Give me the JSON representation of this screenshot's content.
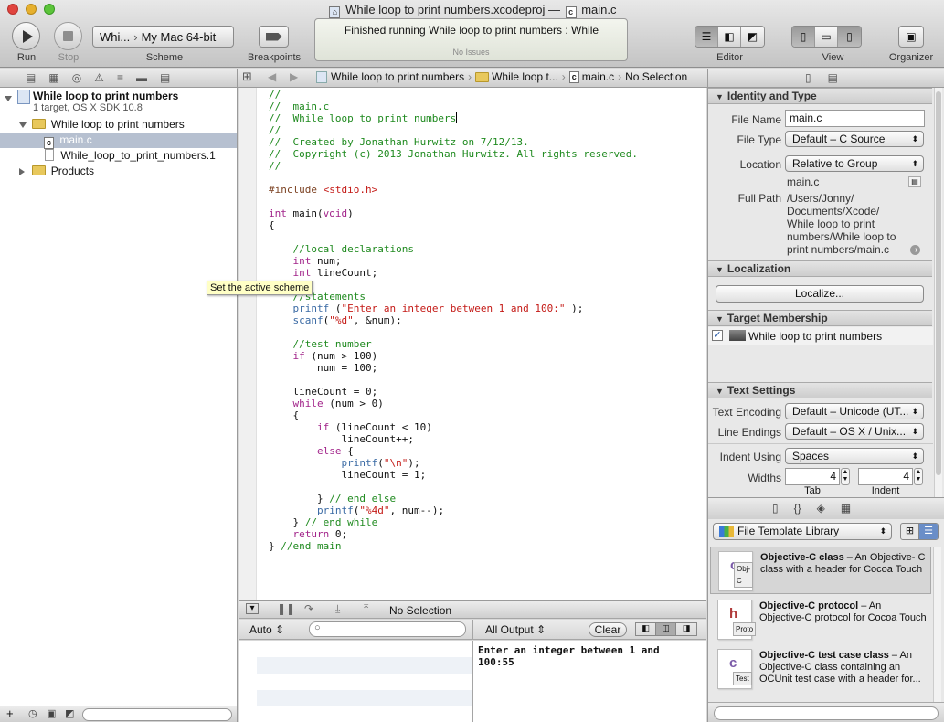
{
  "window": {
    "project_title": "While loop to print numbers.xcodeproj",
    "separator": "—",
    "file_title": "main.c",
    "file_badge": "c"
  },
  "toolbar": {
    "run_label": "Run",
    "stop_label": "Stop",
    "scheme_target": "Whi...",
    "scheme_destination": "My Mac 64-bit",
    "scheme_label": "Scheme",
    "breakpoints_label": "Breakpoints",
    "activity_status": "Finished running While loop to print numbers : While",
    "activity_issues": "No Issues",
    "editor_label": "Editor",
    "view_label": "View",
    "organizer_label": "Organizer"
  },
  "jumpbar": {
    "crumbs": [
      "While loop to print numbers",
      "While loop t...",
      "main.c",
      "No Selection"
    ]
  },
  "navigator": {
    "project": {
      "name": "While loop to print numbers",
      "subtitle": "1 target, OS X SDK 10.8"
    },
    "items": [
      {
        "label": "While loop to print numbers",
        "kind": "folder",
        "expanded": true
      },
      {
        "label": "main.c",
        "kind": "c-file",
        "selected": true
      },
      {
        "label": "While_loop_to_print_numbers.1",
        "kind": "file"
      },
      {
        "label": "Products",
        "kind": "folder",
        "expanded": false
      }
    ]
  },
  "tooltip": "Set the active scheme",
  "editor": {
    "lines": [
      [
        [
          "cm",
          "//"
        ]
      ],
      [
        [
          "cm",
          "//  main.c"
        ]
      ],
      [
        [
          "cm",
          "//  While loop to print numbers"
        ]
      ],
      [
        [
          "cm",
          "//"
        ]
      ],
      [
        [
          "cm",
          "//  Created by Jonathan Hurwitz on 7/12/13."
        ]
      ],
      [
        [
          "cm",
          "//  Copyright (c) 2013 Jonathan Hurwitz. All rights reserved."
        ]
      ],
      [
        [
          "cm",
          "//"
        ]
      ],
      [
        [
          "",
          ""
        ]
      ],
      [
        [
          "pp",
          "#include "
        ],
        [
          "st",
          "<stdio.h>"
        ]
      ],
      [
        [
          "",
          ""
        ]
      ],
      [
        [
          "kw",
          "int"
        ],
        [
          "",
          " main("
        ],
        [
          "kw",
          "void"
        ],
        [
          "",
          ")"
        ]
      ],
      [
        [
          "",
          "{"
        ]
      ],
      [
        [
          "",
          ""
        ]
      ],
      [
        [
          "",
          "    "
        ],
        [
          "cm",
          "//local declarations"
        ]
      ],
      [
        [
          "",
          "    "
        ],
        [
          "kw",
          "int"
        ],
        [
          "",
          " num;"
        ]
      ],
      [
        [
          "",
          "    "
        ],
        [
          "kw",
          "int"
        ],
        [
          "",
          " lineCount;"
        ]
      ],
      [
        [
          "",
          ""
        ]
      ],
      [
        [
          "",
          "    "
        ],
        [
          "cm",
          "//statements"
        ]
      ],
      [
        [
          "",
          "    "
        ],
        [
          "fn",
          "printf"
        ],
        [
          "",
          " ("
        ],
        [
          "st",
          "\"Enter an integer between 1 and 100:\""
        ],
        [
          "",
          " );"
        ]
      ],
      [
        [
          "",
          "    "
        ],
        [
          "fn",
          "scanf"
        ],
        [
          "",
          "("
        ],
        [
          "st",
          "\"%d\""
        ],
        [
          "",
          ", &num);"
        ]
      ],
      [
        [
          "",
          ""
        ]
      ],
      [
        [
          "",
          "    "
        ],
        [
          "cm",
          "//test number"
        ]
      ],
      [
        [
          "",
          "    "
        ],
        [
          "kw",
          "if"
        ],
        [
          "",
          " (num > 100)"
        ]
      ],
      [
        [
          "",
          "        num = 100;"
        ]
      ],
      [
        [
          "",
          ""
        ]
      ],
      [
        [
          "",
          "    lineCount = 0;"
        ]
      ],
      [
        [
          "",
          "    "
        ],
        [
          "kw",
          "while"
        ],
        [
          "",
          " (num > 0)"
        ]
      ],
      [
        [
          "",
          "    {"
        ]
      ],
      [
        [
          "",
          "        "
        ],
        [
          "kw",
          "if"
        ],
        [
          "",
          " (lineCount < 10)"
        ]
      ],
      [
        [
          "",
          "            lineCount++;"
        ]
      ],
      [
        [
          "",
          "        "
        ],
        [
          "kw",
          "else"
        ],
        [
          "",
          " {"
        ]
      ],
      [
        [
          "",
          "            "
        ],
        [
          "fn",
          "printf"
        ],
        [
          "",
          "("
        ],
        [
          "st",
          "\"\\n\""
        ],
        [
          "",
          ");"
        ]
      ],
      [
        [
          "",
          "            lineCount = 1;"
        ]
      ],
      [
        [
          "",
          ""
        ]
      ],
      [
        [
          "",
          "        } "
        ],
        [
          "cm",
          "// end else"
        ]
      ],
      [
        [
          "",
          "        "
        ],
        [
          "fn",
          "printf"
        ],
        [
          "",
          "("
        ],
        [
          "st",
          "\"%4d\""
        ],
        [
          "",
          ", num--);"
        ]
      ],
      [
        [
          "",
          "    } "
        ],
        [
          "cm",
          "// end while"
        ]
      ],
      [
        [
          "",
          "    "
        ],
        [
          "kw",
          "return"
        ],
        [
          "",
          " 0;"
        ]
      ],
      [
        [
          "",
          "} "
        ],
        [
          "cm",
          "//end main"
        ]
      ]
    ]
  },
  "debug": {
    "no_selection": "No Selection",
    "auto_label": "Auto",
    "output_label": "All Output",
    "clear_label": "Clear",
    "console_text": "Enter an integer between 1 and 100:55"
  },
  "inspector": {
    "identity_header": "Identity and Type",
    "file_name_label": "File Name",
    "file_name": "main.c",
    "file_type_label": "File Type",
    "file_type": "Default – C Source",
    "location_label": "Location",
    "location": "Relative to Group",
    "location_value": "main.c",
    "full_path_label": "Full Path",
    "full_path_lines": [
      "/Users/Jonny/",
      "Documents/Xcode/",
      "While loop to print",
      "numbers/While loop to",
      "print numbers/main.c"
    ],
    "localization_header": "Localization",
    "localize_button": "Localize...",
    "target_header": "Target Membership",
    "target_name": "While loop to print numbers",
    "text_header": "Text Settings",
    "encoding_label": "Text Encoding",
    "encoding": "Default – Unicode (UT...",
    "endings_label": "Line Endings",
    "endings": "Default – OS X / Unix...",
    "indent_label": "Indent Using",
    "indent": "Spaces",
    "widths_label": "Widths",
    "tab_value": "4",
    "indent_value": "4",
    "tab_label": "Tab",
    "indent_col_label": "Indent"
  },
  "library": {
    "selector": "File Template Library",
    "items": [
      {
        "title": "Objective-C class",
        "desc_head": " – An Objective-",
        "desc": "C class with a header for Cocoa Touch",
        "badge": "Obj-C",
        "letter": "c",
        "letter_color": "#7a5aa8"
      },
      {
        "title": "Objective-C protocol",
        "desc_head": " – An",
        "desc": "Objective-C protocol for Cocoa Touch",
        "badge": "Proto",
        "letter": "h",
        "letter_color": "#b03a3a"
      },
      {
        "title": "Objective-C test case class",
        "desc_head": " – An",
        "desc": "Objective-C class containing an OCUnit test case with a header for...",
        "badge": "Test",
        "letter": "c",
        "letter_color": "#7a5aa8"
      }
    ]
  }
}
